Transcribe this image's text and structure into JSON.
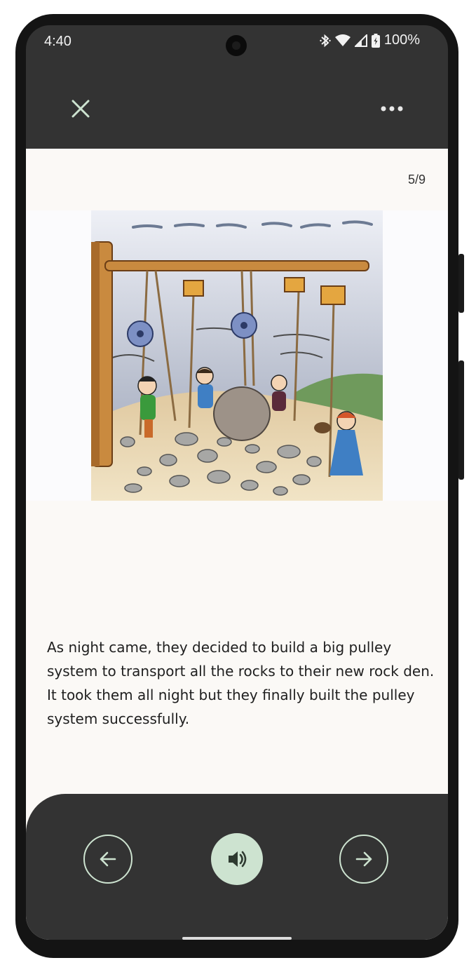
{
  "status_bar": {
    "time": "4:40",
    "battery_percent": "100%",
    "icons": [
      "bluetooth-icon",
      "wifi-icon",
      "cellular-icon",
      "battery-icon"
    ]
  },
  "app_bar": {
    "close_icon": "close-icon",
    "more_icon": "more-horizontal-icon"
  },
  "page": {
    "counter": "5/9",
    "illustration_caption": "",
    "text": "As night came, they decided to build a big pulley system to transport all the rocks to their new rock den.  It took them all night but they finally built the pulley system successfully."
  },
  "controls": {
    "prev_icon": "arrow-left-icon",
    "audio_icon": "speaker-icon",
    "next_icon": "arrow-right-icon"
  },
  "colors": {
    "chrome": "#333333",
    "page_background": "#fbf9f6",
    "accent": "#cde3d0",
    "text": "#1f1f1f"
  }
}
